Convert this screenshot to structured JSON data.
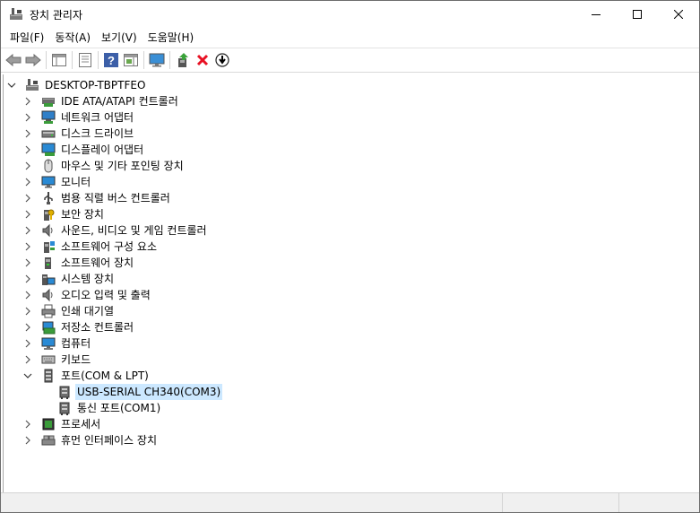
{
  "window": {
    "title": "장치 관리자"
  },
  "menu": [
    "파일(F)",
    "동작(A)",
    "보기(V)",
    "도움말(H)"
  ],
  "tree": {
    "root": "DESKTOP-TBPTFEO",
    "categories": [
      {
        "label": "IDE ATA/ATAPI 컨트롤러",
        "icon": "ide-controller-icon"
      },
      {
        "label": "네트워크 어댑터",
        "icon": "network-adapter-icon"
      },
      {
        "label": "디스크 드라이브",
        "icon": "disk-drive-icon"
      },
      {
        "label": "디스플레이 어댑터",
        "icon": "display-adapter-icon"
      },
      {
        "label": "마우스 및 기타 포인팅 장치",
        "icon": "mouse-icon"
      },
      {
        "label": "모니터",
        "icon": "monitor-icon"
      },
      {
        "label": "범용 직렬 버스 컨트롤러",
        "icon": "usb-controller-icon"
      },
      {
        "label": "보안 장치",
        "icon": "security-device-icon"
      },
      {
        "label": "사운드, 비디오 및 게임 컨트롤러",
        "icon": "sound-icon"
      },
      {
        "label": "소프트웨어 구성 요소",
        "icon": "software-component-icon"
      },
      {
        "label": "소프트웨어 장치",
        "icon": "software-device-icon"
      },
      {
        "label": "시스템 장치",
        "icon": "system-device-icon"
      },
      {
        "label": "오디오 입력 및 출력",
        "icon": "audio-io-icon"
      },
      {
        "label": "인쇄 대기열",
        "icon": "print-queue-icon"
      },
      {
        "label": "저장소 컨트롤러",
        "icon": "storage-controller-icon"
      },
      {
        "label": "컴퓨터",
        "icon": "computer-icon"
      },
      {
        "label": "키보드",
        "icon": "keyboard-icon"
      },
      {
        "label": "포트(COM & LPT)",
        "icon": "port-icon"
      }
    ],
    "ports_children": [
      {
        "label": "USB-SERIAL CH340(COM3)",
        "selected": true
      },
      {
        "label": "통신 포트(COM1)",
        "selected": false
      }
    ],
    "after_ports": [
      {
        "label": "프로세서",
        "icon": "processor-icon"
      },
      {
        "label": "휴먼 인터페이스 장치",
        "icon": "hid-icon"
      }
    ]
  },
  "colors": {
    "selection": "#cce8ff",
    "remove": "#e81123",
    "link_blue": "#0067c0"
  }
}
